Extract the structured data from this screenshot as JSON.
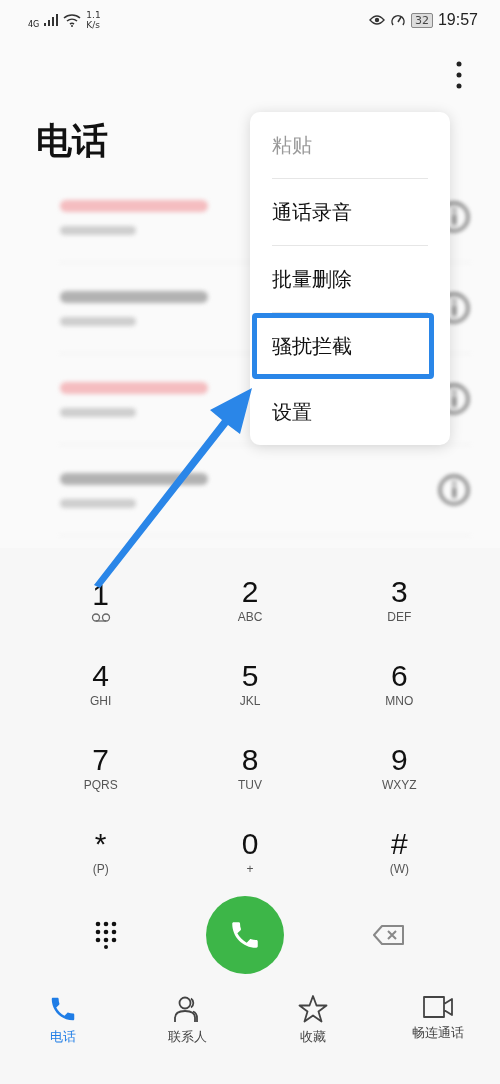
{
  "status_bar": {
    "network": "4G",
    "speed_value": "1.1",
    "speed_unit": "K/s",
    "battery": "32",
    "time": "19:57"
  },
  "title": "电话",
  "calls": [
    {
      "missed": true
    },
    {
      "missed": false
    },
    {
      "missed": true
    },
    {
      "missed": false
    }
  ],
  "menu": [
    {
      "label": "粘贴",
      "disabled": true,
      "highlighted": false
    },
    {
      "label": "通话录音",
      "disabled": false,
      "highlighted": false
    },
    {
      "label": "批量删除",
      "disabled": false,
      "highlighted": false
    },
    {
      "label": "骚扰拦截",
      "disabled": false,
      "highlighted": true
    },
    {
      "label": "设置",
      "disabled": false,
      "highlighted": false
    }
  ],
  "keypad": [
    {
      "digit": "1",
      "kind": "voicemail"
    },
    {
      "digit": "2",
      "kind": "letters",
      "letters": "ABC"
    },
    {
      "digit": "3",
      "kind": "letters",
      "letters": "DEF"
    },
    {
      "digit": "4",
      "kind": "letters",
      "letters": "GHI"
    },
    {
      "digit": "5",
      "kind": "letters",
      "letters": "JKL"
    },
    {
      "digit": "6",
      "kind": "letters",
      "letters": "MNO"
    },
    {
      "digit": "7",
      "kind": "letters",
      "letters": "PQRS"
    },
    {
      "digit": "8",
      "kind": "letters",
      "letters": "TUV"
    },
    {
      "digit": "9",
      "kind": "letters",
      "letters": "WXYZ"
    },
    {
      "digit": "*",
      "kind": "letters",
      "letters": "(P)"
    },
    {
      "digit": "0",
      "kind": "letters",
      "letters": "+"
    },
    {
      "digit": "#",
      "kind": "letters",
      "letters": "(W)"
    }
  ],
  "nav": [
    {
      "label": "电话",
      "kind": "phone",
      "selected": true
    },
    {
      "label": "联系人",
      "kind": "contacts",
      "selected": false
    },
    {
      "label": "收藏",
      "kind": "star",
      "selected": false
    },
    {
      "label": "畅连通话",
      "kind": "video",
      "selected": false
    }
  ]
}
